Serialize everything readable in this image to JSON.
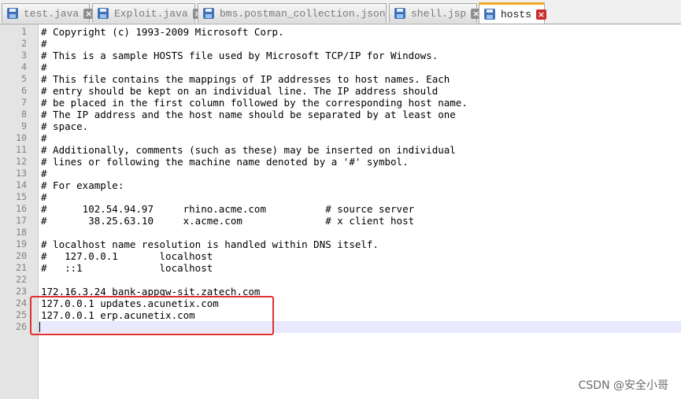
{
  "tabs": [
    {
      "label": "test.java",
      "active": false
    },
    {
      "label": "Exploit.java",
      "active": false
    },
    {
      "label": "bms.postman_collection.json",
      "active": false
    },
    {
      "label": "shell.jsp",
      "active": false
    },
    {
      "label": "hosts",
      "active": true
    }
  ],
  "editor": {
    "current_line": 26,
    "lines": [
      "# Copyright (c) 1993-2009 Microsoft Corp.",
      "#",
      "# This is a sample HOSTS file used by Microsoft TCP/IP for Windows.",
      "#",
      "# This file contains the mappings of IP addresses to host names. Each",
      "# entry should be kept on an individual line. The IP address should",
      "# be placed in the first column followed by the corresponding host name.",
      "# The IP address and the host name should be separated by at least one",
      "# space.",
      "#",
      "# Additionally, comments (such as these) may be inserted on individual",
      "# lines or following the machine name denoted by a '#' symbol.",
      "#",
      "# For example:",
      "#",
      "#      102.54.94.97     rhino.acme.com          # source server",
      "#       38.25.63.10     x.acme.com              # x client host",
      "",
      "# localhost name resolution is handled within DNS itself.",
      "#   127.0.0.1       localhost",
      "#   ::1             localhost",
      "",
      "172.16.3.24 bank-appgw-sit.zatech.com",
      "127.0.0.1 updates.acunetix.com",
      "127.0.0.1 erp.acunetix.com",
      ""
    ]
  },
  "watermark": "CSDN @安全小哥",
  "colors": {
    "active_tab_accent": "#f5a623",
    "annotation_box": "#e03030",
    "gutter_background": "#e4e4e4",
    "current_line_background": "#e8e8ff"
  },
  "icons": {
    "tab_file": "save-icon",
    "tab_close": "close-icon"
  }
}
